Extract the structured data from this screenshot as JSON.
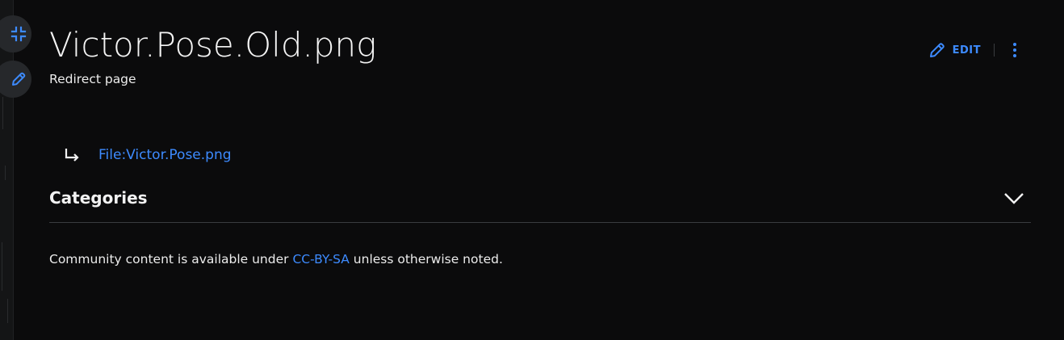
{
  "page": {
    "title": "Victor.Pose.Old.png",
    "subtitle": "Redirect page"
  },
  "header": {
    "edit_label": "EDIT",
    "edit_icon": "pencil-icon",
    "more_icon": "kebab-menu-icon",
    "accent_color": "#3d8bff"
  },
  "rail": {
    "buttons": [
      {
        "icon": "collapse-icon"
      },
      {
        "icon": "pencil-icon"
      }
    ]
  },
  "redirect": {
    "icon": "redirect-arrow-icon",
    "target_label": "File:Victor.Pose.png"
  },
  "categories": {
    "heading": "Categories",
    "icon": "chevron-down-icon"
  },
  "footer": {
    "prefix": "Community content is available under ",
    "license_label": "CC-BY-SA",
    "suffix": " unless otherwise noted."
  }
}
